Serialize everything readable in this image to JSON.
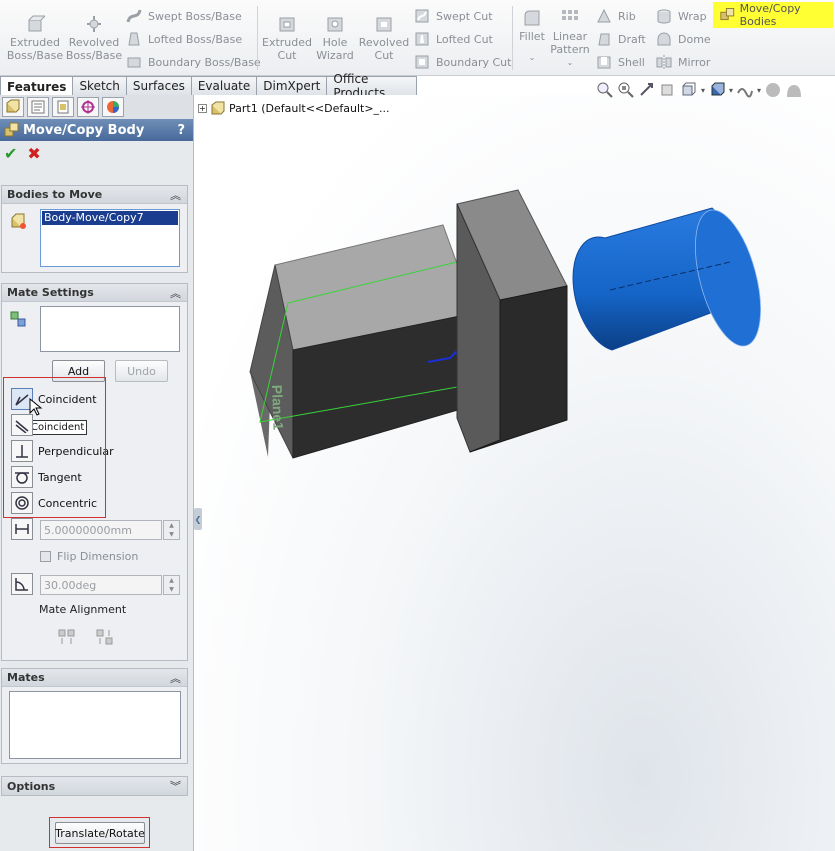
{
  "ribbon": {
    "extruded_boss": "Extruded Boss/Base",
    "revolved_boss": "Revolved Boss/Base",
    "swept_boss": "Swept Boss/Base",
    "lofted_boss": "Lofted Boss/Base",
    "boundary_boss": "Boundary Boss/Base",
    "extruded_cut": "Extruded Cut",
    "hole_wizard": "Hole Wizard",
    "revolved_cut": "Revolved Cut",
    "swept_cut": "Swept Cut",
    "lofted_cut": "Lofted Cut",
    "boundary_cut": "Boundary Cut",
    "fillet": "Fillet",
    "linear_pattern": "Linear Pattern",
    "rib": "Rib",
    "draft": "Draft",
    "shell": "Shell",
    "wrap": "Wrap",
    "dome": "Dome",
    "mirror": "Mirror",
    "move_copy": "Move/Copy Bodies",
    "highlight_color": "#ffff33"
  },
  "tabs": [
    "Features",
    "Sketch",
    "Surfaces",
    "Evaluate",
    "DimXpert",
    "Office Products"
  ],
  "tree": {
    "part_label": "Part1  (Default<<Default>_..."
  },
  "pm": {
    "title": "Move/Copy Body",
    "help": "?",
    "bodies_group": "Bodies to Move",
    "body_item": "Body-Move/Copy7",
    "mate_group": "Mate Settings",
    "add": "Add",
    "undo": "Undo",
    "mates": [
      "Coincident",
      "Parallel",
      "Perpendicular",
      "Tangent",
      "Concentric"
    ],
    "tooltip": "Coincident",
    "distance_value": "5.00000000mm",
    "flip_dimension": "Flip Dimension",
    "angle_value": "30.00deg",
    "mate_alignment": "Mate Alignment",
    "mates_group": "Mates",
    "options_group": "Options",
    "translate_rotate": "Translate/Rotate"
  },
  "viewport": {
    "plane_label": "Plane1",
    "box_color": "#2d2d2d",
    "top_color": "#a8a8a8",
    "cylinder_color": "#1565c8"
  }
}
